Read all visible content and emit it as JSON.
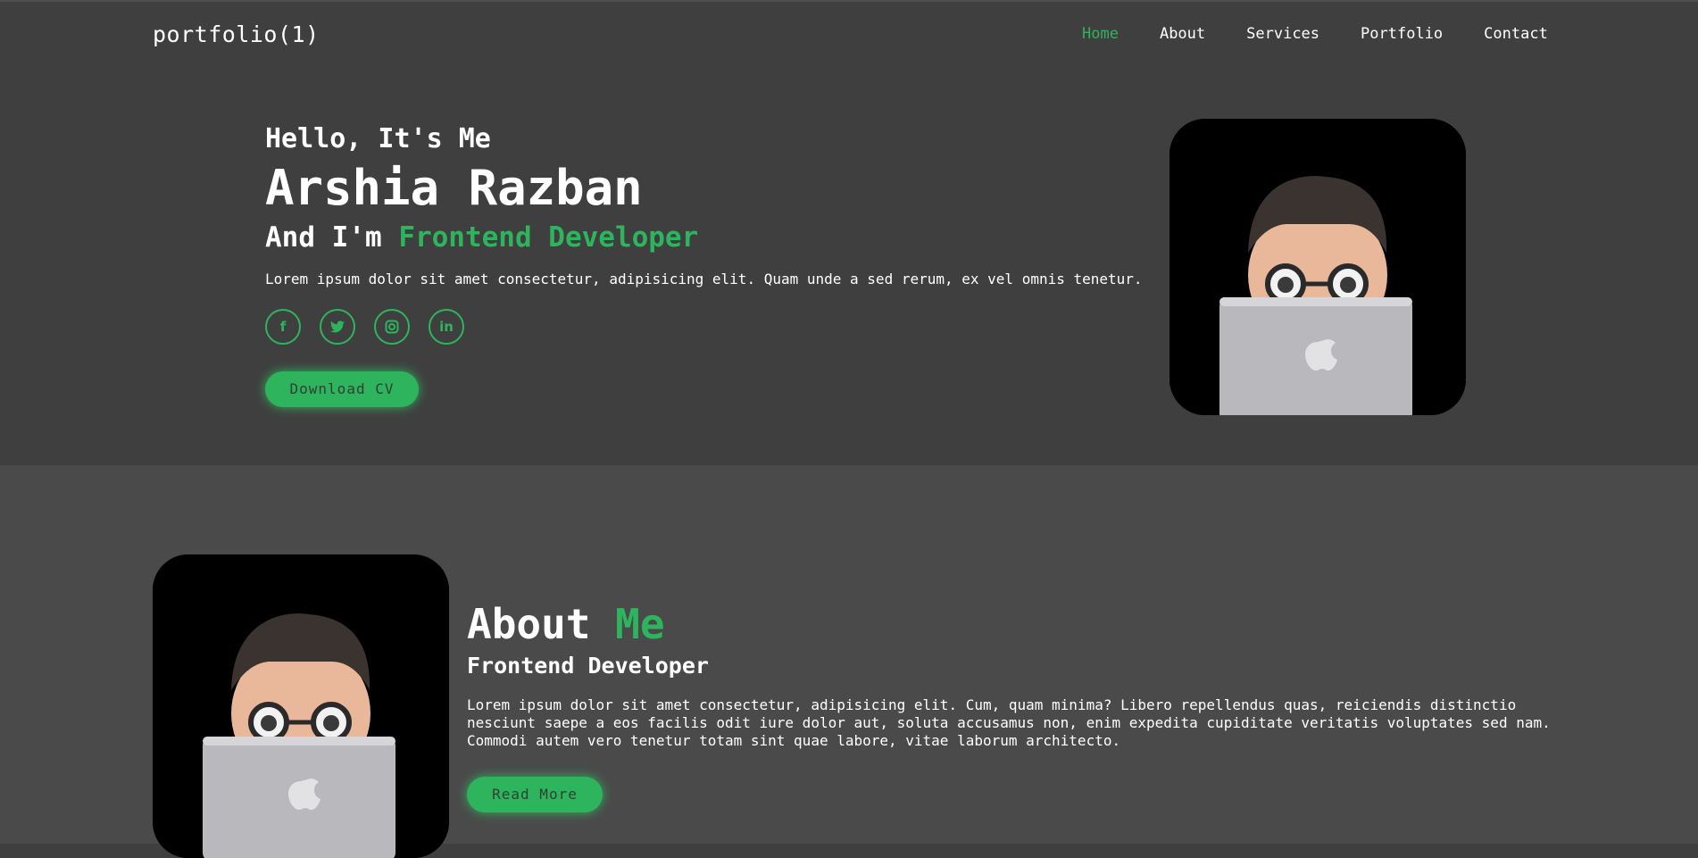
{
  "header": {
    "logo": "portfolio(1)",
    "nav": [
      "Home",
      "About",
      "Services",
      "Portfolio",
      "Contact"
    ]
  },
  "hero": {
    "greeting": "Hello, It's Me",
    "name": "Arshia Razban",
    "role_prefix": "And I'm ",
    "role": "Frontend Developer",
    "description": "Lorem ipsum dolor sit amet consectetur, adipisicing elit. Quam unde a sed rerum, ex vel omnis tenetur.",
    "socials": [
      "facebook-icon",
      "twitter-icon",
      "instagram-icon",
      "linkedin-icon"
    ],
    "social_glyphs": [
      "f",
      "t",
      "◎",
      "in"
    ],
    "cta": "Download CV"
  },
  "about": {
    "title_prefix": "About ",
    "title_accent": "Me",
    "subtitle": "Frontend Developer",
    "description": "Lorem ipsum dolor sit amet consectetur, adipisicing elit. Cum, quam minima? Libero repellendus quas, reiciendis distinctio nesciunt saepe a eos facilis odit iure dolor aut, soluta accusamus non, enim expedita cupiditate veritatis voluptates sed nam. Commodi autem vero tenetur totam sint quae labore, vitae laborum architecto.",
    "cta": "Read More"
  },
  "colors": {
    "accent": "#2fb45e",
    "background_dark": "#3f3f3f",
    "background_section": "#4a4a4a"
  }
}
